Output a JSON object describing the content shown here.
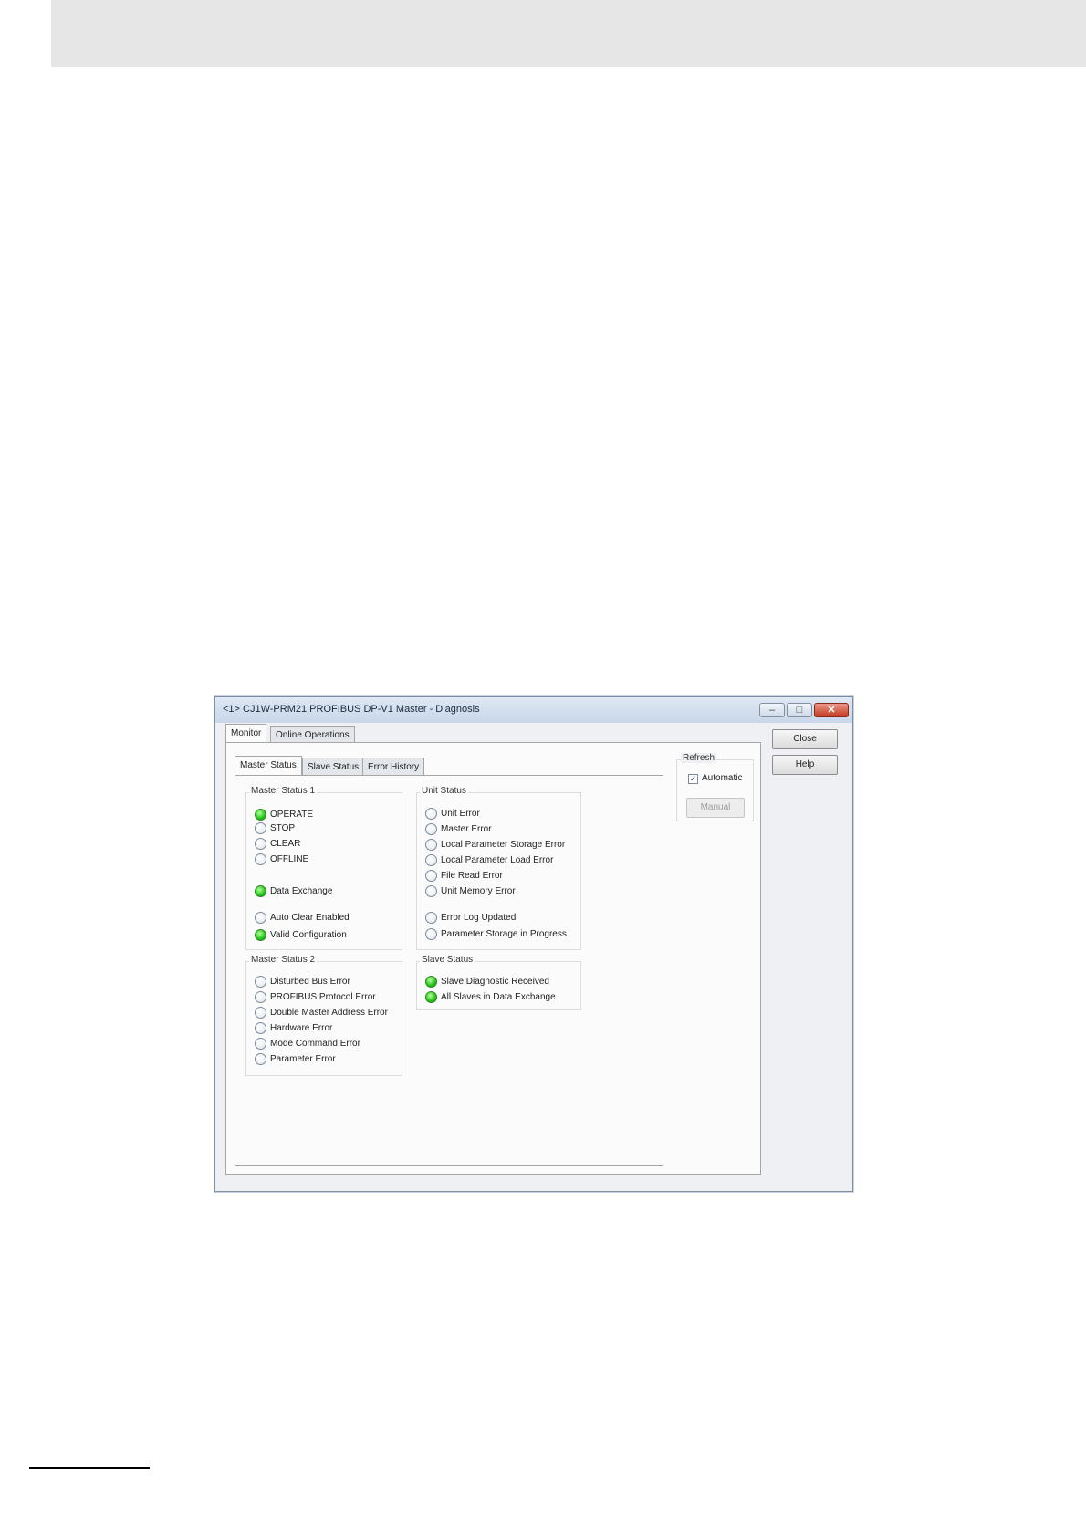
{
  "window": {
    "title": "<1> CJ1W-PRM21 PROFIBUS DP-V1 Master - Diagnosis",
    "controls": {
      "minimize": "–",
      "maximize": "□",
      "close": "✕"
    }
  },
  "top_tabs": [
    {
      "label": "Monitor",
      "active": true
    },
    {
      "label": "Online Operations",
      "active": false
    }
  ],
  "sub_tabs": [
    {
      "label": "Master Status",
      "active": true
    },
    {
      "label": "Slave Status",
      "active": false
    },
    {
      "label": "Error History",
      "active": false
    }
  ],
  "buttons": {
    "close": "Close",
    "help": "Help",
    "manual": "Manual"
  },
  "refresh": {
    "title": "Refresh",
    "automatic_label": "Automatic",
    "automatic_checked": true,
    "check_mark": "✓"
  },
  "groups": {
    "master_status_1": {
      "title": "Master Status 1",
      "items": [
        {
          "label": "OPERATE",
          "on": true
        },
        {
          "label": "STOP",
          "on": false
        },
        {
          "label": "CLEAR",
          "on": false
        },
        {
          "label": "OFFLINE",
          "on": false
        },
        {
          "label": "Data Exchange",
          "on": true
        },
        {
          "label": "Auto Clear Enabled",
          "on": false
        },
        {
          "label": "Valid Configuration",
          "on": true
        }
      ]
    },
    "master_status_2": {
      "title": "Master Status 2",
      "items": [
        {
          "label": "Disturbed Bus Error",
          "on": false
        },
        {
          "label": "PROFIBUS Protocol Error",
          "on": false
        },
        {
          "label": "Double Master Address Error",
          "on": false
        },
        {
          "label": "Hardware Error",
          "on": false
        },
        {
          "label": "Mode Command Error",
          "on": false
        },
        {
          "label": "Parameter Error",
          "on": false
        }
      ]
    },
    "unit_status": {
      "title": "Unit Status",
      "items": [
        {
          "label": "Unit Error",
          "on": false
        },
        {
          "label": "Master Error",
          "on": false
        },
        {
          "label": "Local Parameter Storage Error",
          "on": false
        },
        {
          "label": "Local Parameter Load Error",
          "on": false
        },
        {
          "label": "File Read Error",
          "on": false
        },
        {
          "label": "Unit Memory Error",
          "on": false
        },
        {
          "label": "Error Log Updated",
          "on": false
        },
        {
          "label": "Parameter Storage in Progress",
          "on": false
        }
      ]
    },
    "slave_status": {
      "title": "Slave Status",
      "items": [
        {
          "label": "Slave Diagnostic Received",
          "on": true
        },
        {
          "label": "All Slaves in Data Exchange",
          "on": true
        }
      ]
    }
  }
}
